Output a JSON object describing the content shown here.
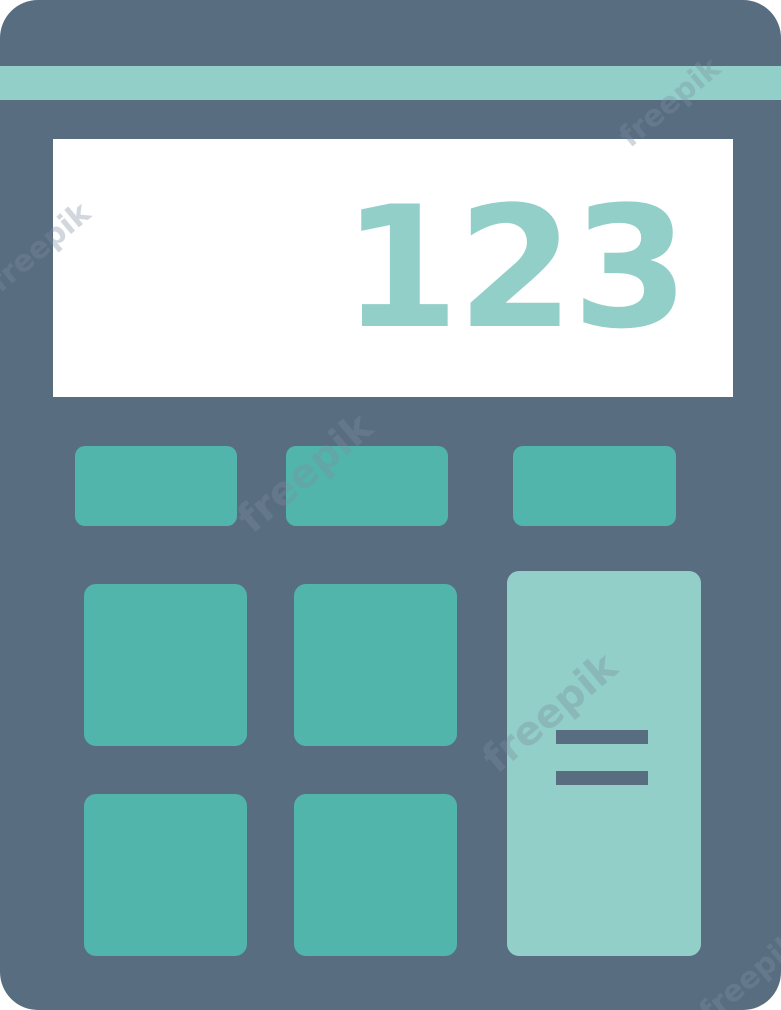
{
  "calculator": {
    "display_value": "123",
    "equals_key_icon": "equals-icon"
  },
  "watermark": {
    "text": "freepik"
  },
  "colors": {
    "body": "#596d81",
    "accent_light": "#92cfc8",
    "key": "#52b5ab",
    "display_bg": "#ffffff"
  }
}
